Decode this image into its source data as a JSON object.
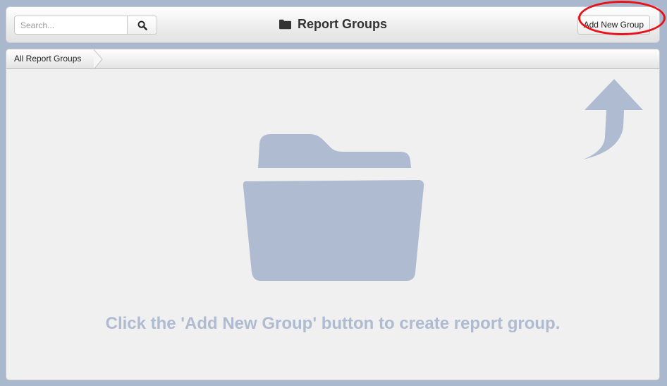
{
  "header": {
    "title": "Report Groups",
    "title_icon": "folder-icon",
    "search": {
      "placeholder": "Search...",
      "value": "",
      "button_icon": "search-icon"
    },
    "add_button_label": "Add New Group"
  },
  "breadcrumb": {
    "items": [
      "All Report Groups"
    ]
  },
  "main": {
    "empty_icon": "folder-open-icon",
    "arrow_icon": "curved-arrow-up-icon",
    "empty_message": "Click the 'Add New Group' button to create report group."
  },
  "colors": {
    "background": "#a9b8cc",
    "panel": "#f0f0f0",
    "illustration": "#aebbd1",
    "highlight": "#e8121b"
  }
}
